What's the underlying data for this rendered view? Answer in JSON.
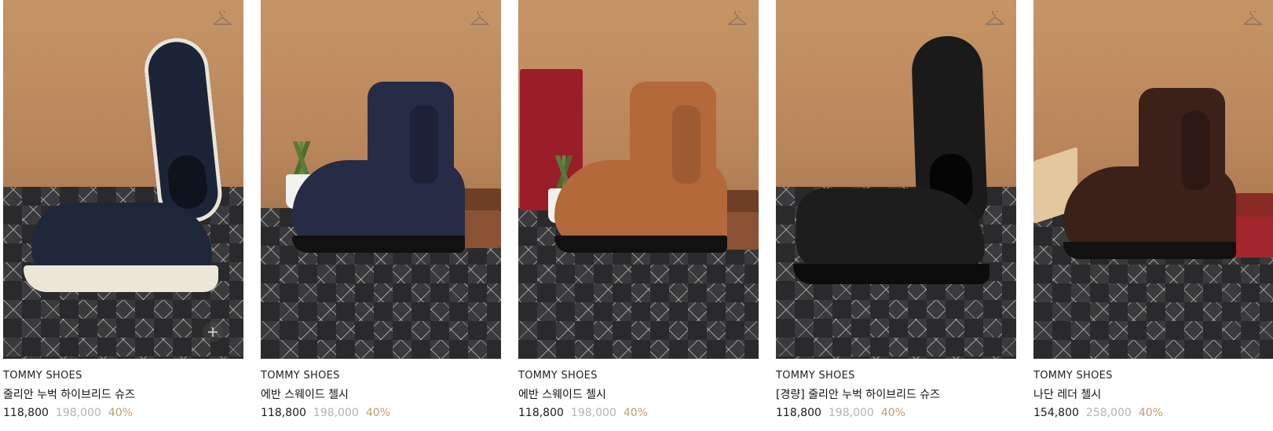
{
  "products": [
    {
      "brand": "TOMMY SHOES",
      "name": "줄리안 누벅 하이브리드 슈즈",
      "sale_price": "118,800",
      "original_price": "198,000",
      "discount": "40%"
    },
    {
      "brand": "TOMMY SHOES",
      "name": "에반 스웨이드 첼시",
      "sale_price": "118,800",
      "original_price": "198,000",
      "discount": "40%"
    },
    {
      "brand": "TOMMY SHOES",
      "name": "에반 스웨이드 첼시",
      "sale_price": "118,800",
      "original_price": "198,000",
      "discount": "40%"
    },
    {
      "brand": "TOMMY SHOES",
      "name": "[경량] 줄리안 누벅 하이브리드 슈즈",
      "sale_price": "118,800",
      "original_price": "198,000",
      "discount": "40%"
    },
    {
      "brand": "TOMMY SHOES",
      "name": "나단 레더 첼시",
      "sale_price": "154,800",
      "original_price": "258,000",
      "discount": "40%"
    }
  ],
  "icons": {
    "wishlist": "hanger-icon",
    "quick_add": "plus-icon"
  },
  "colors": {
    "sale_price": "#1a1a1a",
    "original_price": "#b3b3b3",
    "discount": "#c59b6d",
    "backdrop": "#c69565"
  }
}
